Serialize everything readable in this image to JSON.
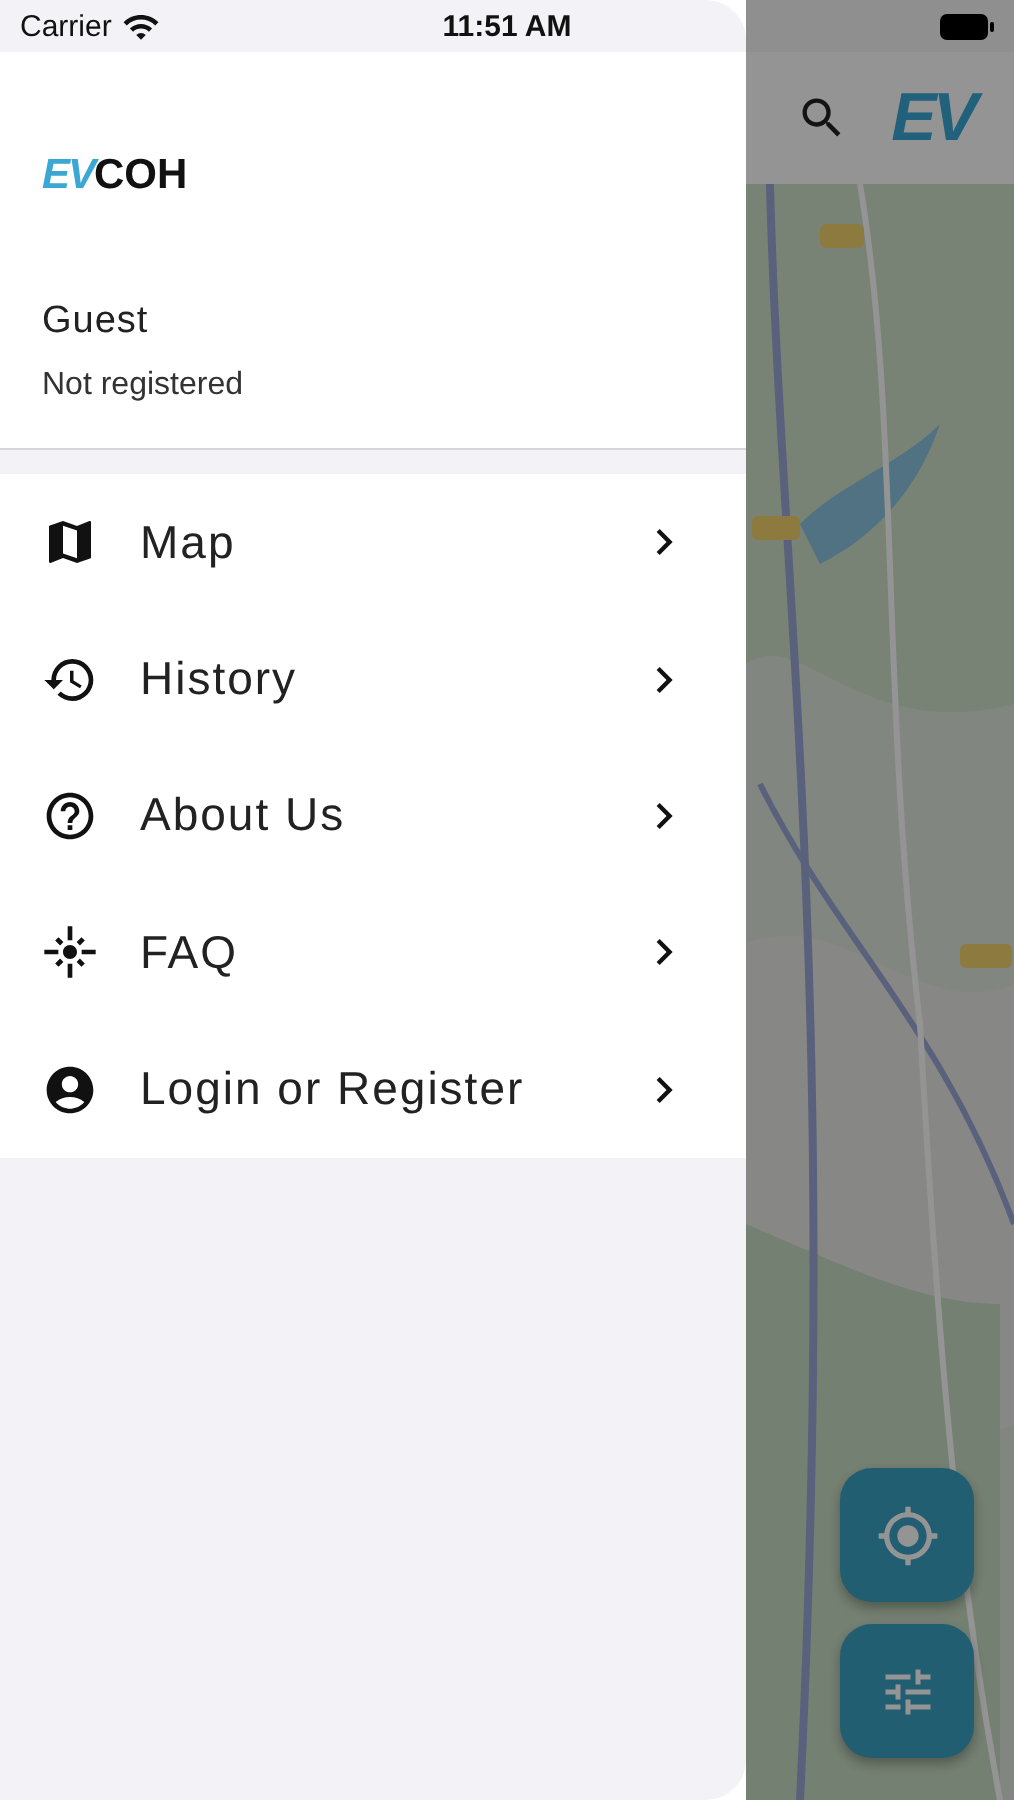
{
  "status_bar": {
    "carrier": "Carrier",
    "time": "11:51 AM"
  },
  "app_bar": {
    "logo": "EV"
  },
  "drawer": {
    "logo": {
      "accent": "EV",
      "text": "COH"
    },
    "user": {
      "name": "Guest",
      "status": "Not registered"
    },
    "items": [
      {
        "kind": "map",
        "label": "Map"
      },
      {
        "kind": "history",
        "label": "History"
      },
      {
        "kind": "about",
        "label": "About Us"
      },
      {
        "kind": "faq",
        "label": "FAQ"
      },
      {
        "kind": "account",
        "label": "Login or Register"
      }
    ]
  }
}
